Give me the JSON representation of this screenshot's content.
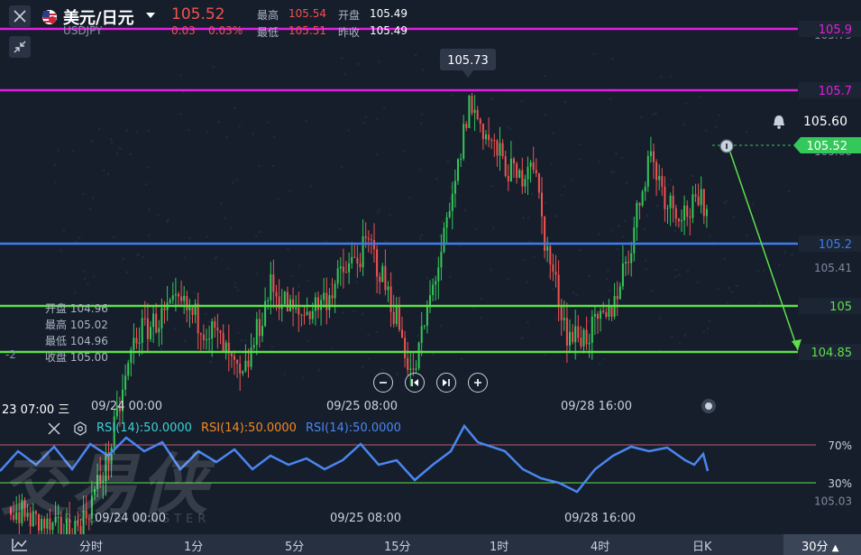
{
  "header": {
    "pair_name": "美元/日元",
    "symbol": "USDJPY",
    "price": "105.52",
    "change": "0.03",
    "change_pct": "0.03%",
    "stats": {
      "high_label": "最高",
      "high_value": "105.54",
      "open_label": "开盘",
      "open_value": "105.49",
      "low_label": "最低",
      "low_value": "105.51",
      "prev_label": "昨收",
      "prev_value": "105.49"
    }
  },
  "chart": {
    "peak_callout": "105.73",
    "current_price": "105.52",
    "y_axis_ticks": [
      "105.79",
      "105.60",
      "105.41",
      "105.03"
    ],
    "hlines": [
      {
        "value": "105.9",
        "color": "#e020e0"
      },
      {
        "value": "105.7",
        "color": "#e020e0"
      },
      {
        "value": "105.2",
        "color": "#3d7cf0"
      },
      {
        "value": "105",
        "color": "#5ee04a"
      },
      {
        "value": "104.85",
        "color": "#5ee04a"
      }
    ],
    "ohlc": [
      {
        "label": "开盘",
        "value": "104.96"
      },
      {
        "label": "最高",
        "value": "105.02"
      },
      {
        "label": "最低",
        "value": "104.96"
      },
      {
        "label": "收盘",
        "value": "105.00"
      }
    ],
    "left_edge_partial": "-2",
    "time_axis": {
      "cursor_label": "23 07:00 三",
      "labels": [
        "09/24 00:00",
        "09/25 08:00",
        "09/28 16:00"
      ]
    }
  },
  "rsi": {
    "legends": [
      {
        "text": "RSI(14):50.0000",
        "color": "#3fd0d4"
      },
      {
        "text": "RSI(14):50.0000",
        "color": "#f08a24"
      },
      {
        "text": "RSI(14):50.0000",
        "color": "#4a86f0"
      }
    ],
    "levels": [
      "70%",
      "30%"
    ],
    "time_labels": [
      "09/24 00:00",
      "09/25 08:00",
      "09/28 16:00"
    ]
  },
  "watermark": {
    "cn": "交易侠",
    "en": "TRADER MASTER"
  },
  "timeframes": [
    "分时",
    "1分",
    "5分",
    "15分",
    "1时",
    "4时",
    "日K"
  ],
  "timeframe_selected": "30分",
  "colors": {
    "up": "#34c759",
    "down": "#ef5350",
    "bg": "#161e2c"
  },
  "icons": {
    "close": "close-icon",
    "collapse": "collapse-icon",
    "flag": "us-flag-icon",
    "dropdown": "caret-down-icon",
    "bell": "bell-icon",
    "info": "info-icon",
    "zoom_out": "zoom-out-icon",
    "prev": "step-back-icon",
    "next": "step-forward-icon",
    "zoom_in": "zoom-in-icon",
    "settings": "settings-icon",
    "indicator": "indicator-icon"
  }
}
